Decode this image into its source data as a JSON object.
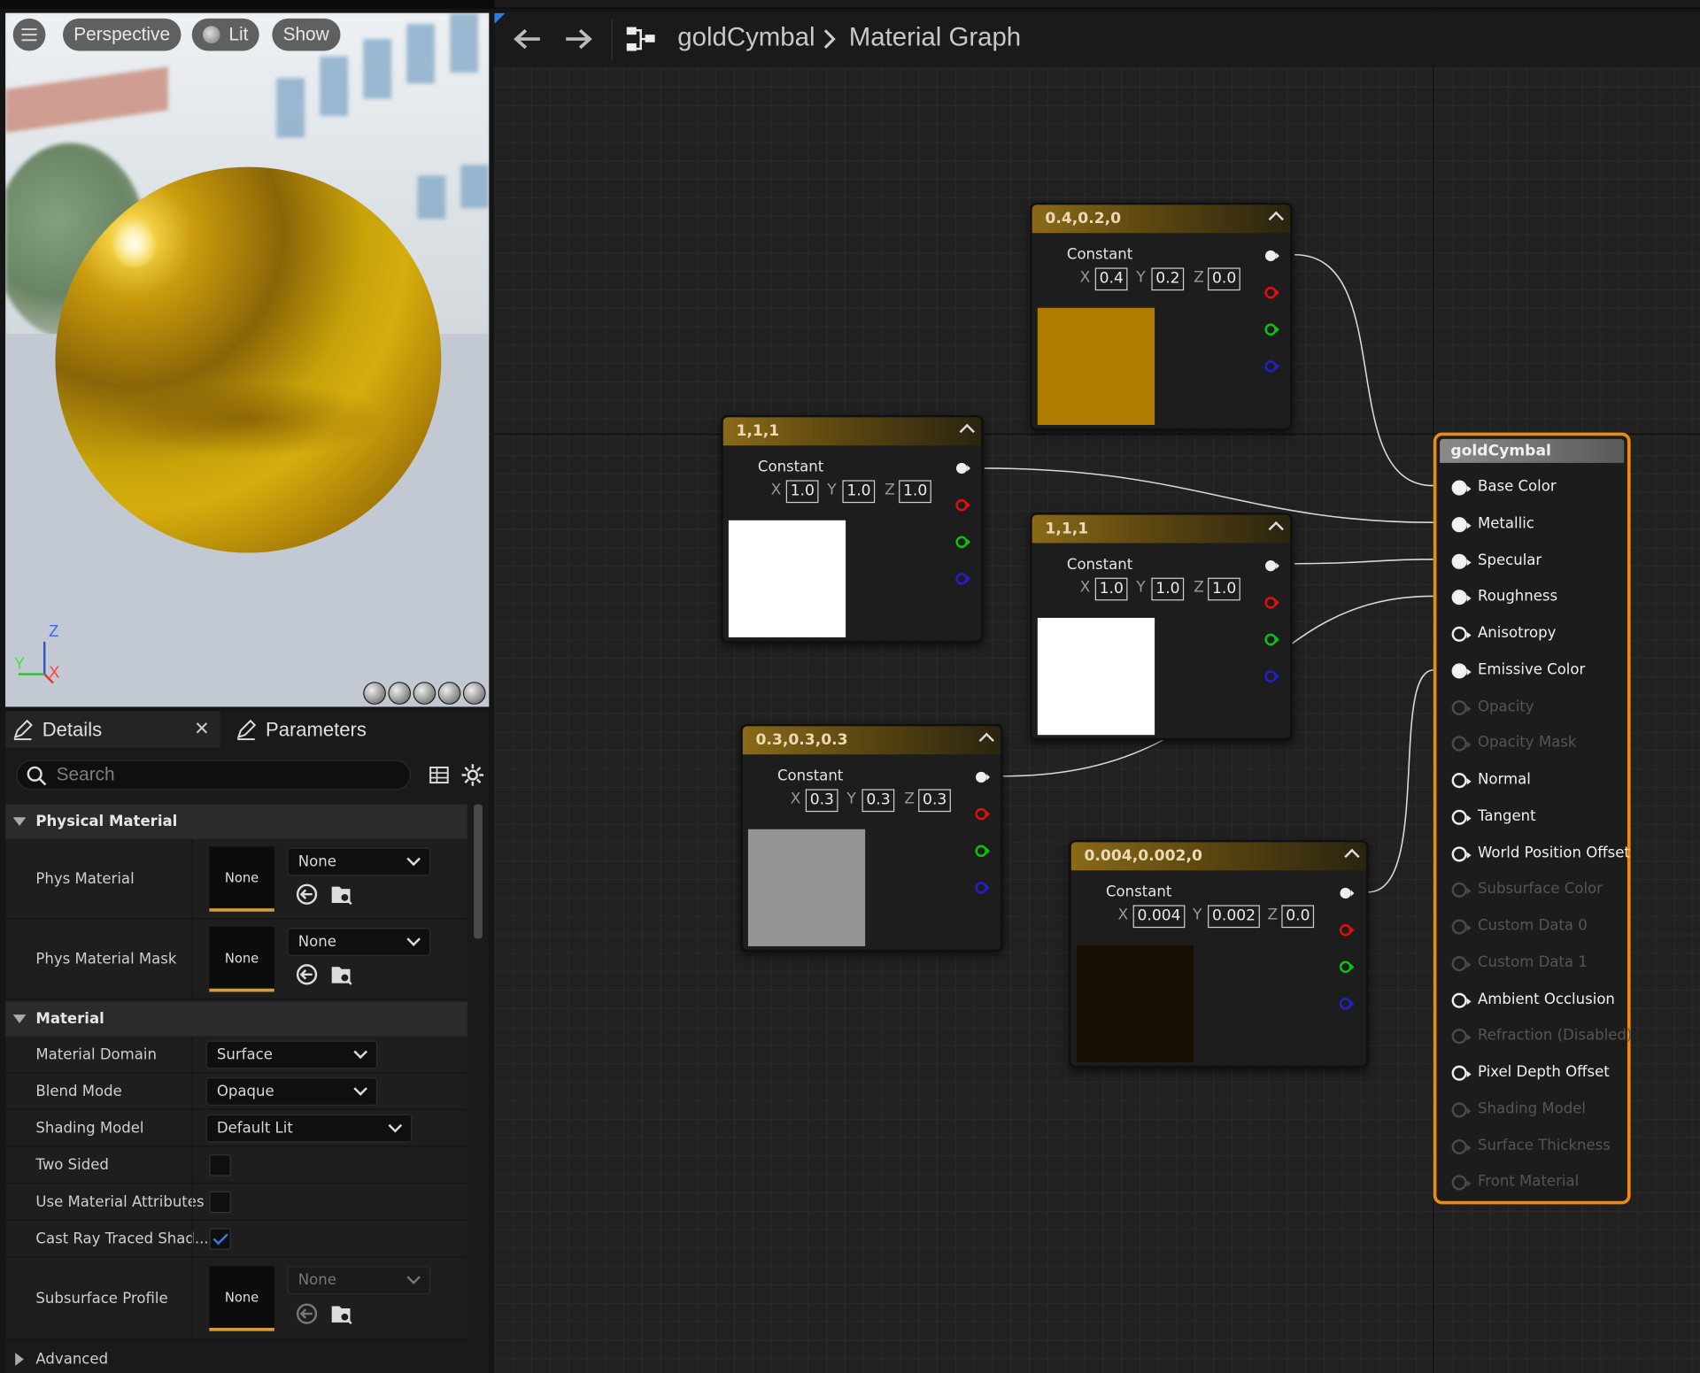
{
  "viewport": {
    "view_mode": "Perspective",
    "lighting_mode": "Lit",
    "show_label": "Show",
    "axis_z": "Z",
    "axis_y": "Y",
    "axis_x": "X"
  },
  "details_panel": {
    "tabs": [
      {
        "label": "Details"
      },
      {
        "label": "Parameters"
      }
    ],
    "search_placeholder": "Search",
    "categories": {
      "physical_material": "Physical Material",
      "material": "Material",
      "advanced": "Advanced"
    },
    "rows": {
      "phys_material": {
        "label": "Phys Material",
        "thumb": "None",
        "value": "None"
      },
      "phys_material_mask": {
        "label": "Phys Material Mask",
        "thumb": "None",
        "value": "None"
      },
      "material_domain": {
        "label": "Material Domain",
        "value": "Surface"
      },
      "blend_mode": {
        "label": "Blend Mode",
        "value": "Opaque"
      },
      "shading_model": {
        "label": "Shading Model",
        "value": "Default Lit"
      },
      "two_sided": {
        "label": "Two Sided",
        "checked": false
      },
      "use_material_attributes": {
        "label": "Use Material Attributes",
        "checked": false
      },
      "cast_ray_traced_shadows": {
        "label": "Cast Ray Traced Shad...",
        "checked": true
      },
      "subsurface_profile": {
        "label": "Subsurface Profile",
        "thumb": "None",
        "value": "None"
      }
    }
  },
  "graph_toolbar": {
    "asset_name": "goldCymbal",
    "graph_name": "Material Graph"
  },
  "nodes": {
    "node_gold": {
      "title": "0.4,0.2,0",
      "label": "Constant",
      "x": "0.4",
      "y": "0.2",
      "z": "0.0",
      "color": "#b07c00"
    },
    "node_white_a": {
      "title": "1,1,1",
      "label": "Constant",
      "x": "1.0",
      "y": "1.0",
      "z": "1.0",
      "color": "#ffffff"
    },
    "node_white_b": {
      "title": "1,1,1",
      "label": "Constant",
      "x": "1.0",
      "y": "1.0",
      "z": "1.0",
      "color": "#ffffff"
    },
    "node_gray": {
      "title": "0.3,0.3,0.3",
      "label": "Constant",
      "x": "0.3",
      "y": "0.3",
      "z": "0.3",
      "color": "#959595"
    },
    "node_dark": {
      "title": "0.004,0.002,0",
      "label": "Constant",
      "x": "0.004",
      "y": "0.002",
      "z": "0.0",
      "color": "#140f00"
    }
  },
  "xyz_labels": {
    "x": "X",
    "y": "Y",
    "z": "Z"
  },
  "result_node": {
    "title": "goldCymbal",
    "inputs": [
      {
        "label": "Base Color",
        "enabled": true,
        "connected": true
      },
      {
        "label": "Metallic",
        "enabled": true,
        "connected": true
      },
      {
        "label": "Specular",
        "enabled": true,
        "connected": true
      },
      {
        "label": "Roughness",
        "enabled": true,
        "connected": true
      },
      {
        "label": "Anisotropy",
        "enabled": true,
        "connected": false
      },
      {
        "label": "Emissive Color",
        "enabled": true,
        "connected": true
      },
      {
        "label": "Opacity",
        "enabled": false,
        "connected": false
      },
      {
        "label": "Opacity Mask",
        "enabled": false,
        "connected": false
      },
      {
        "label": "Normal",
        "enabled": true,
        "connected": false
      },
      {
        "label": "Tangent",
        "enabled": true,
        "connected": false
      },
      {
        "label": "World Position Offset",
        "enabled": true,
        "connected": false
      },
      {
        "label": "Subsurface Color",
        "enabled": false,
        "connected": false
      },
      {
        "label": "Custom Data 0",
        "enabled": false,
        "connected": false
      },
      {
        "label": "Custom Data 1",
        "enabled": false,
        "connected": false
      },
      {
        "label": "Ambient Occlusion",
        "enabled": true,
        "connected": false
      },
      {
        "label": "Refraction (Disabled)",
        "enabled": false,
        "connected": false
      },
      {
        "label": "Pixel Depth Offset",
        "enabled": true,
        "connected": false
      },
      {
        "label": "Shading Model",
        "enabled": false,
        "connected": false
      },
      {
        "label": "Surface Thickness",
        "enabled": false,
        "connected": false
      },
      {
        "label": "Front Material",
        "enabled": false,
        "connected": false
      }
    ]
  },
  "colors": {
    "accent_orange": "#f08a0e",
    "selection_blue": "#2f7fe0",
    "pin_red": "#e01010",
    "pin_green": "#10c010",
    "pin_blue": "#2020d0"
  }
}
